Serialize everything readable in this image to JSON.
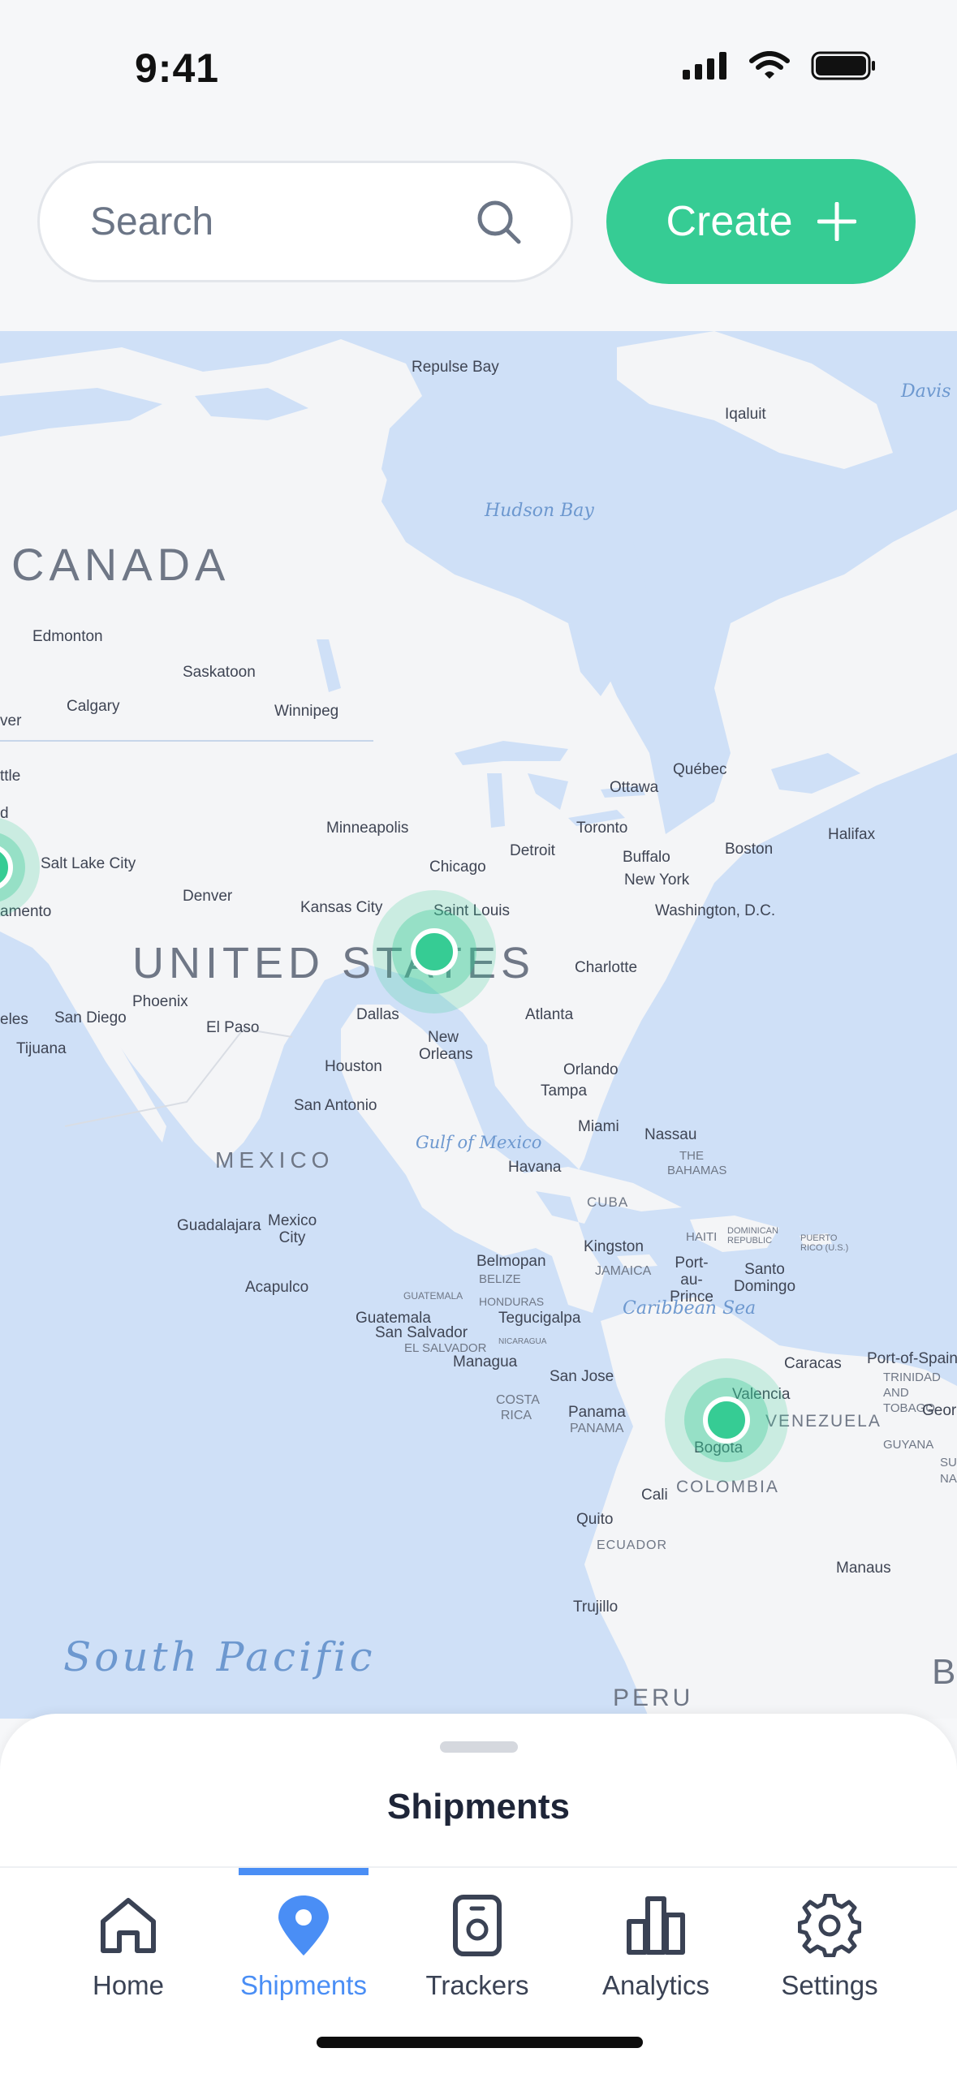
{
  "status_bar": {
    "time": "9:41"
  },
  "search": {
    "placeholder": "Search"
  },
  "create_button": {
    "label": "Create"
  },
  "map": {
    "water_labels": [
      "Hudson Bay",
      "Davis Strait",
      "Gulf of Mexico",
      "Caribbean Sea",
      "South Pacific"
    ],
    "country_labels": [
      "CANADA",
      "UNITED STATES",
      "MEXICO",
      "COLOMBIA",
      "VENEZUELA",
      "PERU",
      "CUBA",
      "ECUADOR",
      "THE BAHAMAS",
      "JAMAICA",
      "HAITI",
      "DOMINICAN REPUBLIC",
      "PUERTO RICO (U.S.)",
      "BELIZE",
      "GUATEMALA",
      "HONDURAS",
      "EL SALVADOR",
      "NICARAGUA",
      "COSTA RICA",
      "PANAMA",
      "GUYANA",
      "TRINIDAD AND TOBAGO",
      "SU",
      "NA",
      "B"
    ],
    "cities": [
      "Repulse Bay",
      "Iqaluit",
      "Edmonton",
      "Saskatoon",
      "Calgary",
      "Winnipeg",
      "ver",
      "ttle",
      "d",
      "Salt Lake City",
      "amento",
      "Minneapolis",
      "Ottawa",
      "Québec",
      "Halifax",
      "Toronto",
      "Buffalo",
      "Detroit",
      "Boston",
      "Chicago",
      "New York",
      "Washington, D.C.",
      "Denver",
      "Kansas City",
      "Saint Louis",
      "Charlotte",
      "Phoenix",
      "Atlanta",
      "eles",
      "San Diego",
      "Tijuana",
      "El Paso",
      "Dallas",
      "New Orleans",
      "Houston",
      "San Antonio",
      "Orlando",
      "Tampa",
      "Miami",
      "Nassau",
      "Havana",
      "Guadalajara",
      "Mexico City",
      "Acapulco",
      "Kingston",
      "Port-au-Prince",
      "Santo Domingo",
      "Belmopan",
      "Guatemala",
      "Tegucigalpa",
      "San Salvador",
      "Managua",
      "San Jose",
      "Panama",
      "Caracas",
      "Port-of-Spain",
      "Valencia",
      "Georg",
      "Bogota",
      "Cali",
      "Quito",
      "Manaus",
      "Trujillo"
    ],
    "markers": [
      {
        "name": "western-us"
      },
      {
        "name": "saint-louis"
      },
      {
        "name": "bogota"
      }
    ]
  },
  "sheet": {
    "title": "Shipments"
  },
  "tabs": [
    {
      "label": "Home",
      "icon": "home-icon",
      "active": false
    },
    {
      "label": "Shipments",
      "icon": "location-pin-icon",
      "active": true
    },
    {
      "label": "Trackers",
      "icon": "tracker-device-icon",
      "active": false
    },
    {
      "label": "Analytics",
      "icon": "bar-chart-icon",
      "active": false
    },
    {
      "label": "Settings",
      "icon": "gear-icon",
      "active": false
    }
  ],
  "colors": {
    "accent": "#36cc94",
    "active_tab": "#4a8ef5",
    "water": "#cfe0f7",
    "land": "#f4f5f7"
  }
}
